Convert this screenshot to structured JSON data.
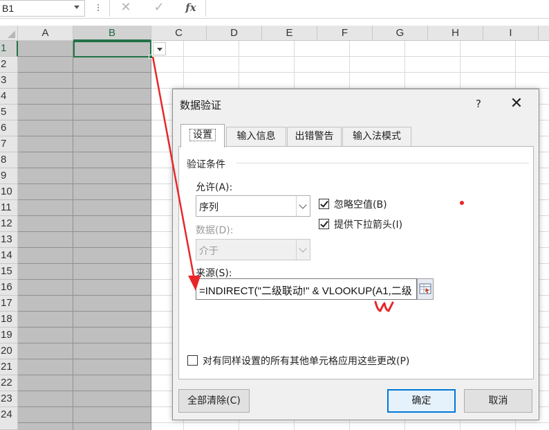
{
  "formula_bar": {
    "name_box": "B1",
    "cancel_icon": "✕",
    "enter_icon": "✓",
    "fx_label": "fx"
  },
  "sheet": {
    "columns": [
      "A",
      "B",
      "C",
      "D",
      "E",
      "F",
      "G",
      "H",
      "I"
    ],
    "rows": [
      "1",
      "2",
      "3",
      "4",
      "5",
      "6",
      "7",
      "8",
      "9",
      "10",
      "11",
      "12",
      "13",
      "14",
      "15",
      "16",
      "17",
      "18",
      "19",
      "20",
      "21",
      "22",
      "23",
      "24"
    ],
    "selected_cell": "B1",
    "colors": {
      "gridline": "#d9d9d9",
      "header_bg": "#e6e6e6",
      "selected_fill": "#bfbfbf",
      "selection_border": "#217346"
    }
  },
  "dialog": {
    "title": "数据验证",
    "help": "?",
    "close": "✕",
    "tabs": [
      "设置",
      "输入信息",
      "出错警告",
      "输入法模式"
    ],
    "active_tab": "设置",
    "group_title": "验证条件",
    "allow_label": "允许(A):",
    "allow_value": "序列",
    "data_label": "数据(D):",
    "data_value": "介于",
    "ignore_blank": {
      "label": "忽略空值(B)",
      "checked": true
    },
    "in_cell_dropdown": {
      "label": "提供下拉箭头(I)",
      "checked": true
    },
    "source_label": "来源(S):",
    "source_value": "=INDIRECT(\"二级联动!\" & VLOOKUP(A1,二级",
    "apply_all": {
      "label": "对有同样设置的所有其他单元格应用这些更改(P)",
      "checked": false
    },
    "clear_all_button": "全部清除(C)",
    "ok_button": "确定",
    "cancel_button": "取消",
    "accent_color": "#0078d7"
  },
  "annotations": {
    "color": "#e8262a"
  }
}
